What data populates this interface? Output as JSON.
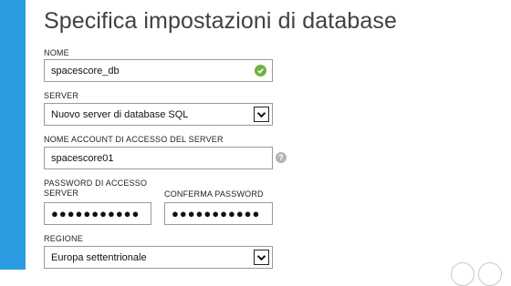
{
  "colors": {
    "accent": "#2a9be0",
    "ok": "#6db33f"
  },
  "page": {
    "title": "Specifica impostazioni di database"
  },
  "fields": {
    "name": {
      "label": "NOME",
      "value": "spacescore_db",
      "status_icon": "check-icon"
    },
    "server": {
      "label": "SERVER",
      "selected": "Nuovo server di database SQL"
    },
    "login": {
      "label": "NOME ACCOUNT DI ACCESSO DEL SERVER",
      "value": "spacescore01",
      "help_icon": "question-icon",
      "help_glyph": "?"
    },
    "password": {
      "label_line1": "PASSWORD DI ACCESSO",
      "label_line2": "SERVER",
      "masked": "●●●●●●●●●●●"
    },
    "confirm_password": {
      "label": "CONFERMA PASSWORD",
      "masked": "●●●●●●●●●●●"
    },
    "region": {
      "label": "REGIONE",
      "selected": "Europa settentrionale"
    }
  }
}
